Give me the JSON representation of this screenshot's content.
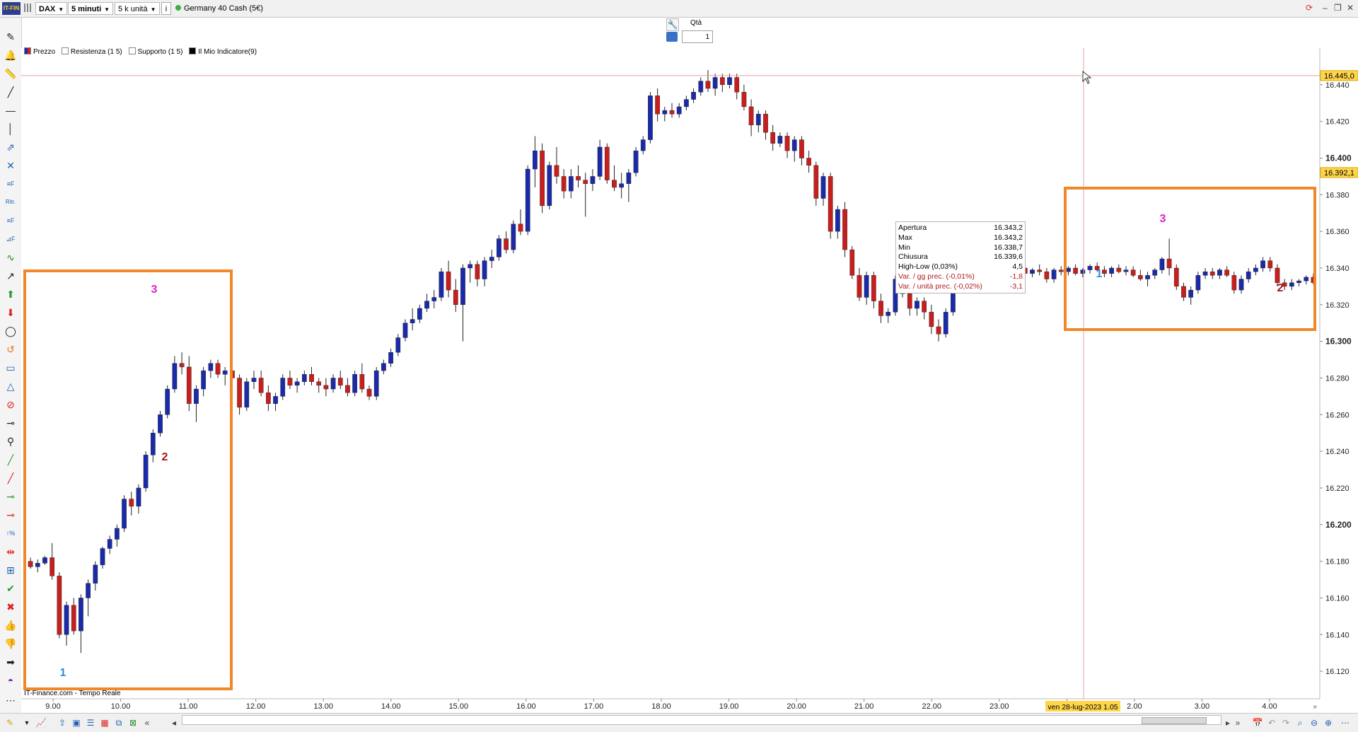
{
  "toolbar": {
    "logo": "IT-FIN",
    "symbol": "DAX",
    "timeframe": "5 minuti",
    "units": "5 k unità",
    "info_icon": "i",
    "instrument": "Germany 40 Cash (5€)",
    "status_color": "#3cb043"
  },
  "order": {
    "qty_label": "Qtà",
    "qty_value": "1"
  },
  "legend": {
    "items": [
      {
        "label": "Prezzo",
        "color": "#1a2aa8"
      },
      {
        "label": "Resistenza (1 5)",
        "color": "#ffffff"
      },
      {
        "label": "Supporto (1 5)",
        "color": "#ffffff"
      },
      {
        "label": "Il Mio Indicatore(9)",
        "color": "#000000"
      }
    ]
  },
  "footer_text": "IT-Finance.com - Tempo Reale",
  "tooltip": {
    "rows": [
      {
        "label": "Apertura",
        "value": "16.343,2"
      },
      {
        "label": "Max",
        "value": "16.343,2"
      },
      {
        "label": "Min",
        "value": "16.338,7"
      },
      {
        "label": "Chiusura",
        "value": "16.339,6"
      },
      {
        "label": "High-Low (0,03%)",
        "value": "4,5"
      }
    ],
    "red_rows": [
      {
        "label": "Var. / gg prec. (-0,01%)",
        "value": "-1,8"
      },
      {
        "label": "Var. / unità prec. (-0,02%)",
        "value": "-3,1"
      }
    ]
  },
  "annotations": {
    "left_box": {
      "n1": "1",
      "n2": "2",
      "n3": "3"
    },
    "right_box": {
      "n1": "1",
      "n2": "2",
      "n3": "3"
    },
    "box_color": "#f0882a",
    "color_1": "#2a8ee0",
    "color_2": "#a01818",
    "color_3": "#e020c8"
  },
  "chart_data": {
    "type": "candlestick",
    "instrument": "Germany 40 Cash (5€)",
    "timeframe": "5 minuti",
    "y_ticks": [
      "16.440",
      "16.420",
      "16.400",
      "16.380",
      "16.360",
      "16.340",
      "16.320",
      "16.300",
      "16.280",
      "16.260",
      "16.240",
      "16.220",
      "16.200",
      "16.180",
      "16.160",
      "16.140",
      "16.120"
    ],
    "y_ticks_bold": [
      "16.400",
      "16.300",
      "16.200"
    ],
    "ylim": [
      16105,
      16460
    ],
    "x_ticks": [
      "9.00",
      "10.00",
      "11.00",
      "12.00",
      "13.00",
      "14.00",
      "15.00",
      "16.00",
      "17.00",
      "18.00",
      "19.00",
      "20.00",
      "21.00",
      "22.00",
      "23.00",
      "28",
      "2.00",
      "3.00",
      "4.00"
    ],
    "x_tick_bold": "28",
    "price_markers": [
      {
        "label": "16.445,0",
        "value": 16445.0
      },
      {
        "label": "16.392,1",
        "value": 16392.1
      }
    ],
    "crosshair_label": "ven 28-lug-2023 1.05",
    "candles": [
      [
        16180,
        16182,
        16176,
        16177
      ],
      [
        16177,
        16181,
        16174,
        16179
      ],
      [
        16179,
        16183,
        16178,
        16182
      ],
      [
        16182,
        16190,
        16170,
        16172
      ],
      [
        16172,
        16174,
        16138,
        16140
      ],
      [
        16140,
        16158,
        16134,
        16156
      ],
      [
        16156,
        16160,
        16140,
        16142
      ],
      [
        16142,
        16162,
        16130,
        16160
      ],
      [
        16160,
        16170,
        16150,
        16168
      ],
      [
        16168,
        16180,
        16164,
        16178
      ],
      [
        16178,
        16188,
        16176,
        16187
      ],
      [
        16187,
        16194,
        16184,
        16192
      ],
      [
        16192,
        16200,
        16188,
        16198
      ],
      [
        16198,
        16216,
        16196,
        16214
      ],
      [
        16214,
        16218,
        16205,
        16210
      ],
      [
        16210,
        16222,
        16206,
        16220
      ],
      [
        16220,
        16240,
        16218,
        16238
      ],
      [
        16238,
        16252,
        16234,
        16250
      ],
      [
        16250,
        16262,
        16248,
        16260
      ],
      [
        16260,
        16276,
        16258,
        16274
      ],
      [
        16274,
        16292,
        16272,
        16288
      ],
      [
        16288,
        16294,
        16282,
        16286
      ],
      [
        16286,
        16292,
        16262,
        16266
      ],
      [
        16266,
        16276,
        16256,
        16274
      ],
      [
        16274,
        16286,
        16270,
        16284
      ],
      [
        16284,
        16290,
        16280,
        16288
      ],
      [
        16288,
        16290,
        16280,
        16282
      ],
      [
        16282,
        16286,
        16276,
        16284
      ],
      [
        16284,
        16286,
        16278,
        16280
      ],
      [
        16280,
        16282,
        16260,
        16264
      ],
      [
        16264,
        16280,
        16262,
        16278
      ],
      [
        16278,
        16284,
        16274,
        16280
      ],
      [
        16280,
        16284,
        16270,
        16272
      ],
      [
        16272,
        16276,
        16262,
        16266
      ],
      [
        16266,
        16272,
        16262,
        16270
      ],
      [
        16270,
        16282,
        16268,
        16280
      ],
      [
        16280,
        16284,
        16274,
        16276
      ],
      [
        16276,
        16280,
        16272,
        16278
      ],
      [
        16278,
        16284,
        16276,
        16282
      ],
      [
        16282,
        16286,
        16276,
        16278
      ],
      [
        16278,
        16280,
        16272,
        16276
      ],
      [
        16276,
        16280,
        16270,
        16274
      ],
      [
        16274,
        16282,
        16272,
        16280
      ],
      [
        16280,
        16284,
        16274,
        16276
      ],
      [
        16276,
        16280,
        16270,
        16272
      ],
      [
        16272,
        16284,
        16270,
        16282
      ],
      [
        16282,
        16288,
        16272,
        16274
      ],
      [
        16274,
        16276,
        16268,
        16270
      ],
      [
        16270,
        16286,
        16268,
        16284
      ],
      [
        16284,
        16290,
        16282,
        16288
      ],
      [
        16288,
        16296,
        16286,
        16294
      ],
      [
        16294,
        16304,
        16292,
        16302
      ],
      [
        16302,
        16312,
        16300,
        16310
      ],
      [
        16310,
        16318,
        16306,
        16312
      ],
      [
        16312,
        16320,
        16310,
        16318
      ],
      [
        16318,
        16326,
        16316,
        16322
      ],
      [
        16322,
        16328,
        16318,
        16324
      ],
      [
        16324,
        16340,
        16322,
        16338
      ],
      [
        16338,
        16344,
        16324,
        16328
      ],
      [
        16328,
        16334,
        16316,
        16320
      ],
      [
        16320,
        16342,
        16300,
        16340
      ],
      [
        16340,
        16344,
        16332,
        16342
      ],
      [
        16342,
        16344,
        16330,
        16334
      ],
      [
        16334,
        16346,
        16330,
        16344
      ],
      [
        16344,
        16350,
        16340,
        16346
      ],
      [
        16346,
        16358,
        16344,
        16356
      ],
      [
        16356,
        16360,
        16348,
        16350
      ],
      [
        16350,
        16366,
        16348,
        16364
      ],
      [
        16364,
        16372,
        16358,
        16360
      ],
      [
        16360,
        16396,
        16358,
        16394
      ],
      [
        16394,
        16412,
        16384,
        16404
      ],
      [
        16404,
        16408,
        16370,
        16374
      ],
      [
        16374,
        16398,
        16372,
        16396
      ],
      [
        16396,
        16406,
        16386,
        16390
      ],
      [
        16390,
        16394,
        16378,
        16382
      ],
      [
        16382,
        16394,
        16378,
        16390
      ],
      [
        16390,
        16396,
        16384,
        16388
      ],
      [
        16388,
        16392,
        16368,
        16386
      ],
      [
        16386,
        16394,
        16382,
        16390
      ],
      [
        16390,
        16410,
        16388,
        16406
      ],
      [
        16406,
        16408,
        16386,
        16388
      ],
      [
        16388,
        16396,
        16382,
        16384
      ],
      [
        16384,
        16392,
        16378,
        16386
      ],
      [
        16386,
        16394,
        16376,
        16392
      ],
      [
        16392,
        16406,
        16390,
        16404
      ],
      [
        16404,
        16412,
        16402,
        16410
      ],
      [
        16410,
        16436,
        16408,
        16434
      ],
      [
        16434,
        16438,
        16420,
        16424
      ],
      [
        16424,
        16428,
        16420,
        16426
      ],
      [
        16426,
        16430,
        16422,
        16424
      ],
      [
        16424,
        16430,
        16422,
        16428
      ],
      [
        16428,
        16434,
        16426,
        16432
      ],
      [
        16432,
        16438,
        16430,
        16436
      ],
      [
        16436,
        16444,
        16434,
        16442
      ],
      [
        16442,
        16448,
        16436,
        16438
      ],
      [
        16438,
        16446,
        16434,
        16444
      ],
      [
        16444,
        16446,
        16436,
        16440
      ],
      [
        16440,
        16446,
        16438,
        16444
      ],
      [
        16444,
        16446,
        16432,
        16436
      ],
      [
        16436,
        16440,
        16426,
        16428
      ],
      [
        16428,
        16432,
        16412,
        16418
      ],
      [
        16418,
        16426,
        16414,
        16424
      ],
      [
        16424,
        16426,
        16410,
        16414
      ],
      [
        16414,
        16418,
        16404,
        16408
      ],
      [
        16408,
        16414,
        16406,
        16412
      ],
      [
        16412,
        16414,
        16400,
        16404
      ],
      [
        16404,
        16412,
        16398,
        16410
      ],
      [
        16410,
        16412,
        16396,
        16400
      ],
      [
        16400,
        16404,
        16392,
        16396
      ],
      [
        16396,
        16398,
        16374,
        16378
      ],
      [
        16378,
        16392,
        16374,
        16390
      ],
      [
        16390,
        16392,
        16356,
        16360
      ],
      [
        16360,
        16374,
        16356,
        16372
      ],
      [
        16372,
        16376,
        16346,
        16350
      ],
      [
        16350,
        16352,
        16334,
        16336
      ],
      [
        16336,
        16340,
        16322,
        16324
      ],
      [
        16324,
        16338,
        16320,
        16336
      ],
      [
        16336,
        16338,
        16318,
        16322
      ],
      [
        16322,
        16326,
        16310,
        16314
      ],
      [
        16314,
        16318,
        16310,
        16316
      ],
      [
        16316,
        16336,
        16314,
        16334
      ],
      [
        16334,
        16340,
        16324,
        16326
      ],
      [
        16326,
        16330,
        16314,
        16318
      ],
      [
        16318,
        16324,
        16314,
        16322
      ],
      [
        16322,
        16324,
        16312,
        16316
      ],
      [
        16316,
        16320,
        16304,
        16308
      ],
      [
        16308,
        16312,
        16300,
        16304
      ],
      [
        16304,
        16318,
        16302,
        16316
      ],
      [
        16316,
        16338,
        16314,
        16336
      ],
      [
        16336,
        16342,
        16330,
        16340
      ],
      [
        16340,
        16344,
        16334,
        16338
      ],
      [
        16338,
        16342,
        16334,
        16340
      ],
      [
        16340,
        16342,
        16336,
        16338
      ],
      [
        16338,
        16342,
        16336,
        16340
      ],
      [
        16340,
        16341,
        16336,
        16339
      ],
      [
        16339,
        16342,
        16337,
        16341
      ],
      [
        16341,
        16343,
        16337,
        16338
      ],
      [
        16338,
        16341,
        16336,
        16340
      ],
      [
        16340,
        16342,
        16336,
        16337
      ],
      [
        16337,
        16340,
        16335,
        16339
      ],
      [
        16339,
        16342,
        16336,
        16338
      ],
      [
        16338,
        16340,
        16332,
        16334
      ],
      [
        16334,
        16340,
        16332,
        16339
      ],
      [
        16339,
        16341,
        16336,
        16338
      ],
      [
        16338,
        16341,
        16336,
        16340
      ],
      [
        16340,
        16342,
        16336,
        16337
      ],
      [
        16337,
        16340,
        16335,
        16339
      ],
      [
        16339,
        16342,
        16337,
        16341
      ],
      [
        16341,
        16343,
        16338,
        16339
      ],
      [
        16339,
        16341,
        16335,
        16337
      ],
      [
        16337,
        16341,
        16335,
        16340
      ],
      [
        16340,
        16342,
        16337,
        16338
      ],
      [
        16338,
        16341,
        16336,
        16339
      ],
      [
        16339,
        16341,
        16335,
        16336
      ],
      [
        16336,
        16339,
        16333,
        16334
      ],
      [
        16334,
        16338,
        16330,
        16336
      ],
      [
        16336,
        16340,
        16334,
        16339
      ],
      [
        16339,
        16346,
        16337,
        16345
      ],
      [
        16345,
        16356,
        16336,
        16340
      ],
      [
        16340,
        16342,
        16328,
        16330
      ],
      [
        16330,
        16332,
        16322,
        16324
      ],
      [
        16324,
        16330,
        16320,
        16328
      ],
      [
        16328,
        16338,
        16326,
        16336
      ],
      [
        16336,
        16340,
        16334,
        16338
      ],
      [
        16338,
        16340,
        16334,
        16336
      ],
      [
        16336,
        16340,
        16334,
        16339
      ],
      [
        16339,
        16341,
        16335,
        16336
      ],
      [
        16336,
        16338,
        16326,
        16328
      ],
      [
        16328,
        16336,
        16326,
        16334
      ],
      [
        16334,
        16340,
        16332,
        16338
      ],
      [
        16338,
        16342,
        16336,
        16340
      ],
      [
        16340,
        16346,
        16338,
        16344
      ],
      [
        16344,
        16346,
        16338,
        16340
      ],
      [
        16340,
        16342,
        16330,
        16332
      ],
      [
        16332,
        16334,
        16328,
        16330
      ],
      [
        16330,
        16334,
        16328,
        16332
      ],
      [
        16332,
        16334,
        16330,
        16333
      ],
      [
        16333,
        16336,
        16331,
        16335
      ],
      [
        16335,
        16337,
        16331,
        16332
      ]
    ]
  }
}
